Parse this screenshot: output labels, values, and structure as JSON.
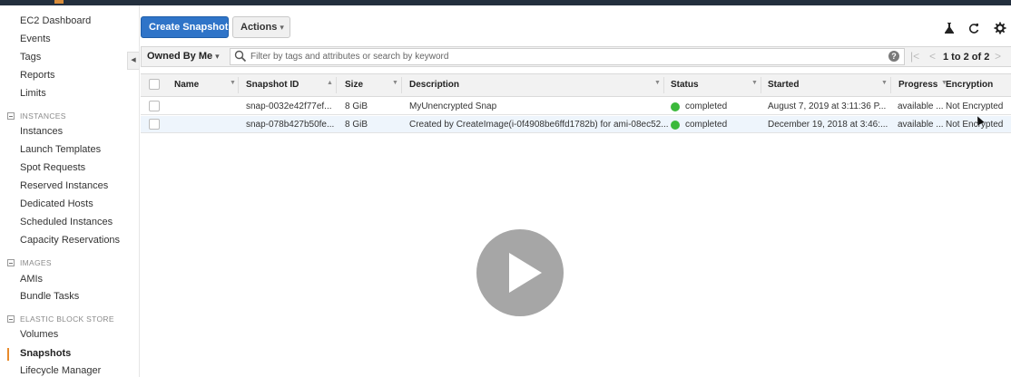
{
  "sidebar": {
    "items": [
      {
        "label": "EC2 Dashboard"
      },
      {
        "label": "Events"
      },
      {
        "label": "Tags"
      },
      {
        "label": "Reports"
      },
      {
        "label": "Limits"
      }
    ],
    "sections": [
      {
        "title": "INSTANCES",
        "items": [
          "Instances",
          "Launch Templates",
          "Spot Requests",
          "Reserved Instances",
          "Dedicated Hosts",
          "Scheduled Instances",
          "Capacity Reservations"
        ]
      },
      {
        "title": "IMAGES",
        "items": [
          "AMIs",
          "Bundle Tasks"
        ]
      },
      {
        "title": "ELASTIC BLOCK STORE",
        "items": [
          "Volumes",
          "Snapshots",
          "Lifecycle Manager"
        ]
      }
    ],
    "active": "Snapshots"
  },
  "toolbar": {
    "create_label": "Create Snapshot",
    "actions_label": "Actions"
  },
  "filter": {
    "owned_label": "Owned By Me",
    "search_placeholder": "Filter by tags and attributes or search by keyword",
    "pager_text": "1 to 2 of 2"
  },
  "table": {
    "columns": [
      "Name",
      "Snapshot ID",
      "Size",
      "Description",
      "Status",
      "Started",
      "Progress",
      "Encryption"
    ],
    "rows": [
      {
        "name": "",
        "snapshot_id": "snap-0032e42f77ef...",
        "size": "8 GiB",
        "description": "MyUnencrypted Snap",
        "status": "completed",
        "started": "August 7, 2019 at 3:11:36 P...",
        "progress": "available ...",
        "encryption": "Not Encrypted"
      },
      {
        "name": "",
        "snapshot_id": "snap-078b427b50fe...",
        "size": "8 GiB",
        "description": "Created by CreateImage(i-0f4908be6ffd1782b) for ami-08ec52...",
        "status": "completed",
        "started": "December 19, 2018 at 3:46:...",
        "progress": "available ...",
        "encryption": "Not Encrypted"
      }
    ]
  },
  "colors": {
    "primary_button": "#2f74c8",
    "status_completed": "#3bb93b",
    "active_marker": "#e88a2b"
  }
}
